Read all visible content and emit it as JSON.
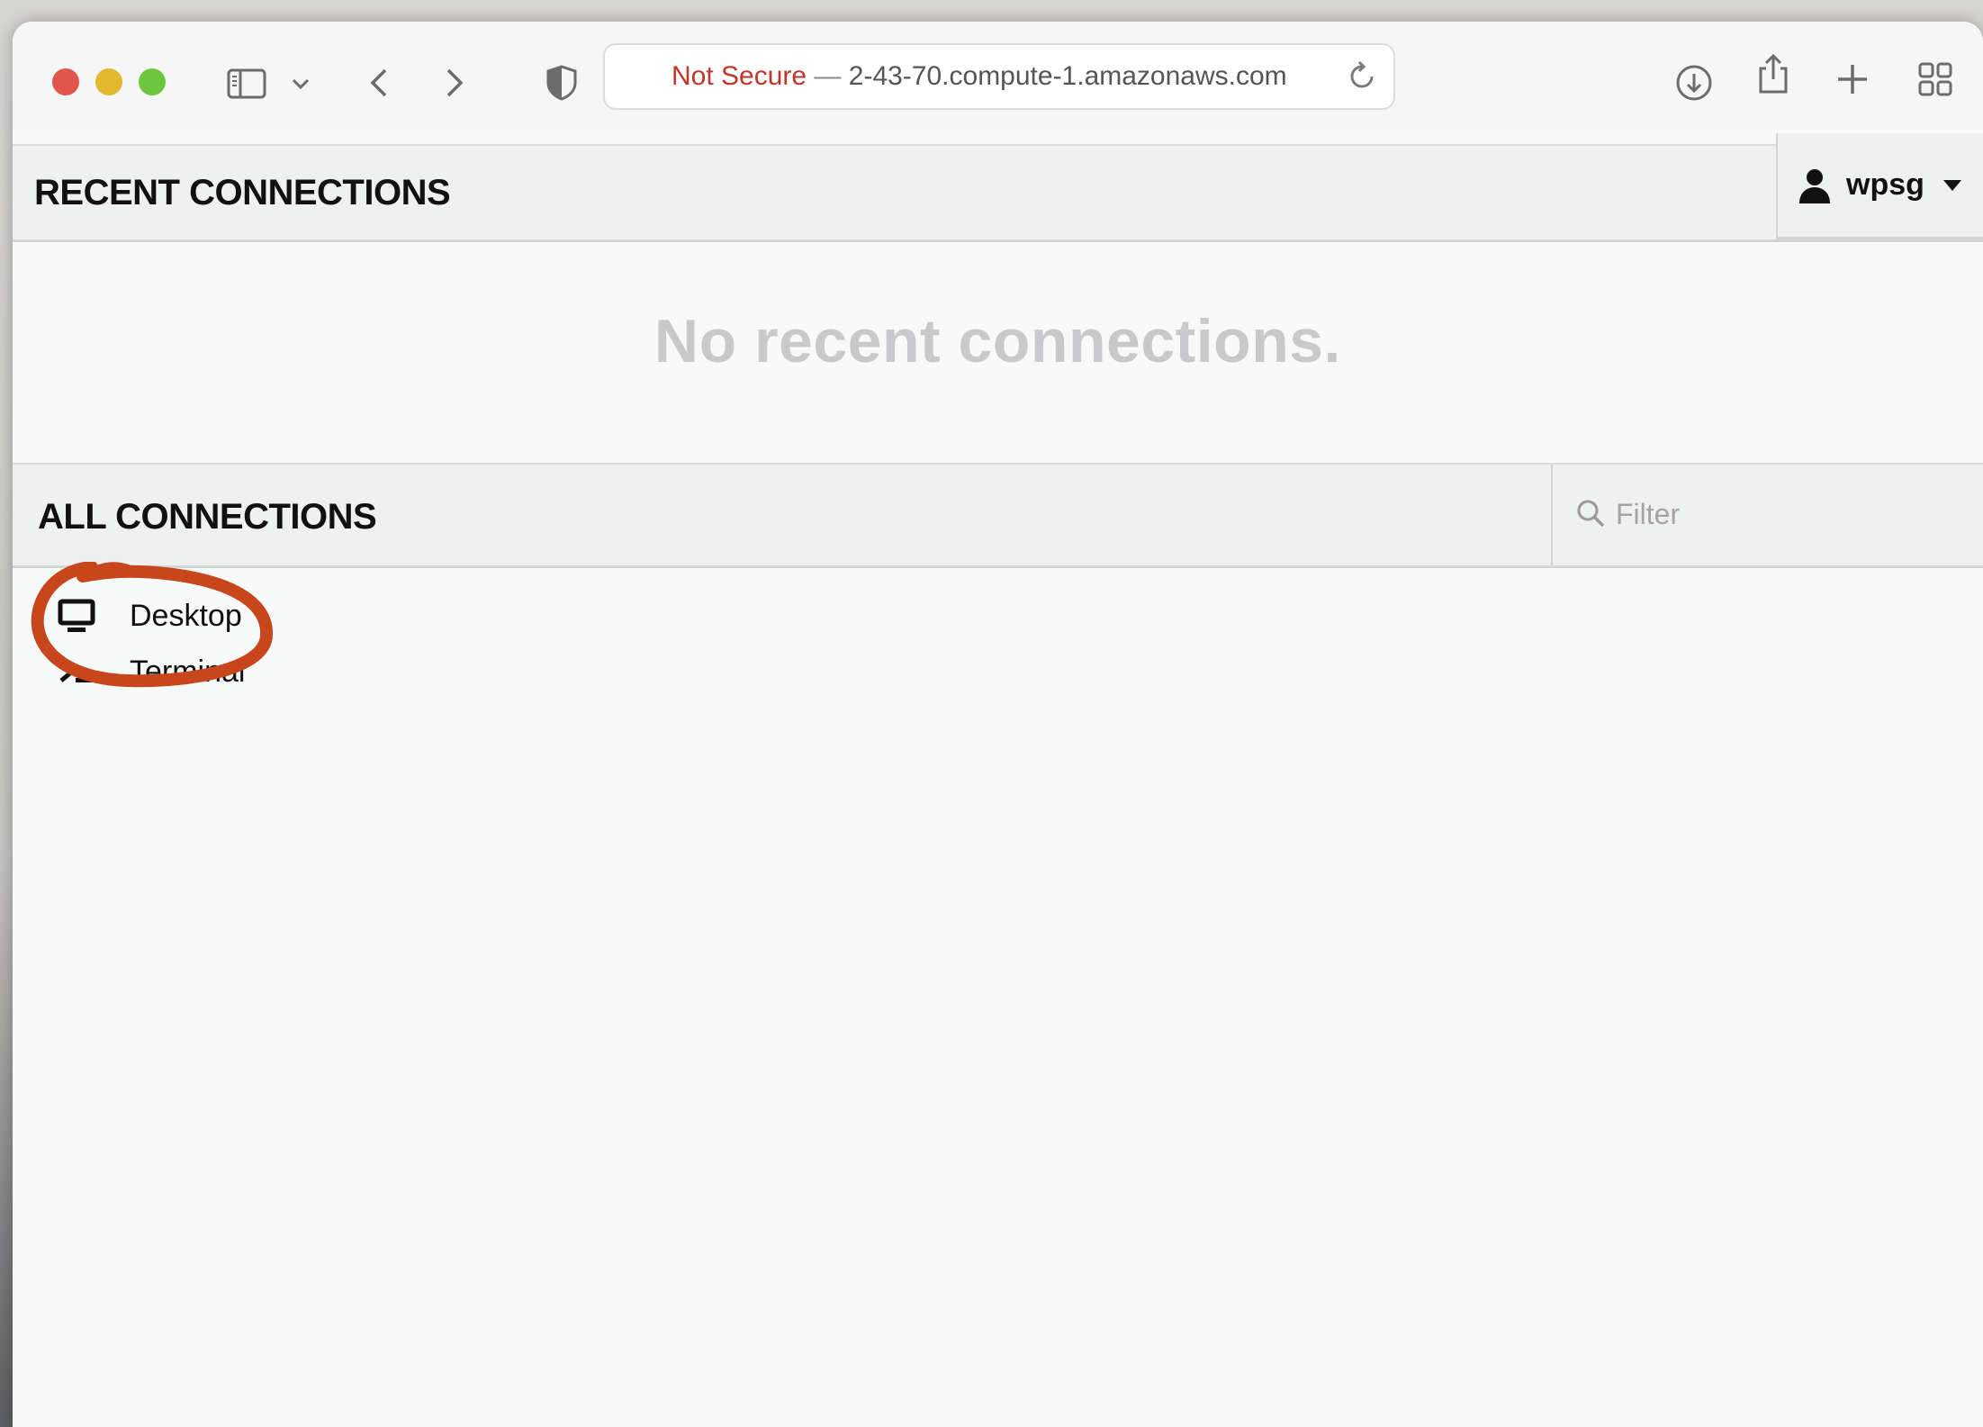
{
  "browser": {
    "url": {
      "security_label": "Not Secure",
      "separator": "—",
      "host": "2-43-70.compute-1.amazonaws.com"
    },
    "icons": {
      "sidebar": "sidebar-icon",
      "sidebar_menu": "chevron-down-icon",
      "back": "back-arrow-icon",
      "forward": "forward-arrow-icon",
      "privacy": "shield-icon",
      "reload": "reload-icon",
      "downloads": "download-icon",
      "share": "share-icon",
      "new_tab": "plus-icon",
      "tab_overview": "grid-icon"
    },
    "colors": {
      "close": "#e0564c",
      "minimize": "#e2b92d",
      "maximize": "#6cc63e",
      "insecure": "#c1362c"
    }
  },
  "recent": {
    "title": "RECENT CONNECTIONS",
    "empty_message": "No recent connections."
  },
  "user_menu": {
    "username": "wpsg"
  },
  "all": {
    "title": "ALL CONNECTIONS",
    "filter_placeholder": "Filter",
    "items": [
      {
        "label": "Desktop",
        "icon": "monitor-icon"
      },
      {
        "label": "Terminal",
        "icon": "terminal-icon"
      }
    ]
  },
  "annotation": {
    "color": "#c8461c"
  }
}
